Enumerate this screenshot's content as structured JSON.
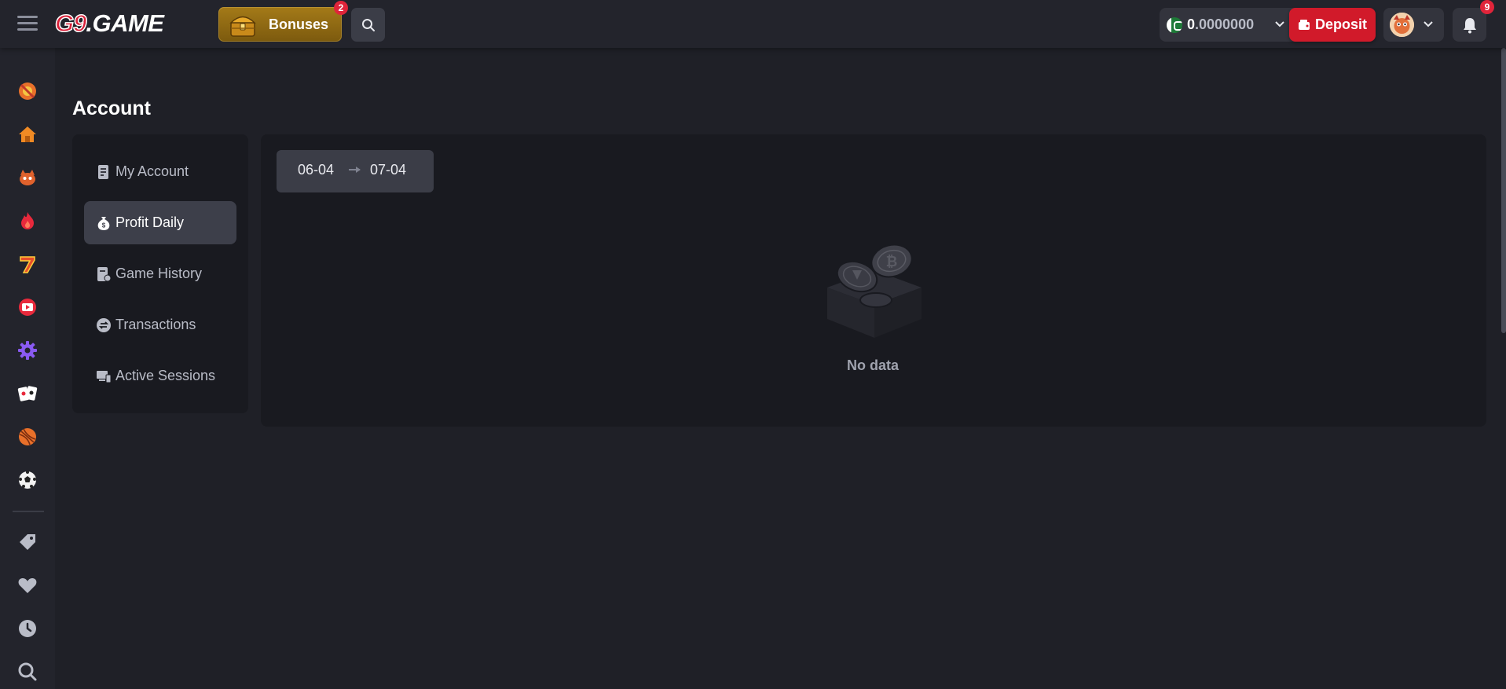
{
  "header": {
    "logo_g9": "G9",
    "logo_game": ".GAME",
    "bonuses_label": "Bonuses",
    "bonuses_badge": "2",
    "balance_int": "0",
    "balance_dec": ".0000000",
    "deposit_label": "Deposit",
    "notifications_badge": "9",
    "accent_color": "#d11a2a"
  },
  "rail": {
    "items": [
      "promo-icon",
      "home-icon",
      "fox-icon",
      "fire-icon",
      "seven-icon",
      "live-icon",
      "gear-icon",
      "cards-icon",
      "ball-icon",
      "soccer-icon",
      "tag-icon",
      "heart-icon",
      "clock-icon",
      "search-icon"
    ]
  },
  "page": {
    "title": "Account"
  },
  "menu": {
    "items": [
      {
        "label": "My Account",
        "icon": "document-icon"
      },
      {
        "label": "Profit Daily",
        "icon": "money-bag-icon",
        "active": true
      },
      {
        "label": "Game History",
        "icon": "history-icon"
      },
      {
        "label": "Transactions",
        "icon": "exchange-icon"
      },
      {
        "label": "Active Sessions",
        "icon": "devices-icon"
      }
    ]
  },
  "filter": {
    "date_start": "06-04",
    "date_end": "07-04"
  },
  "empty_state": {
    "text": "No data"
  }
}
